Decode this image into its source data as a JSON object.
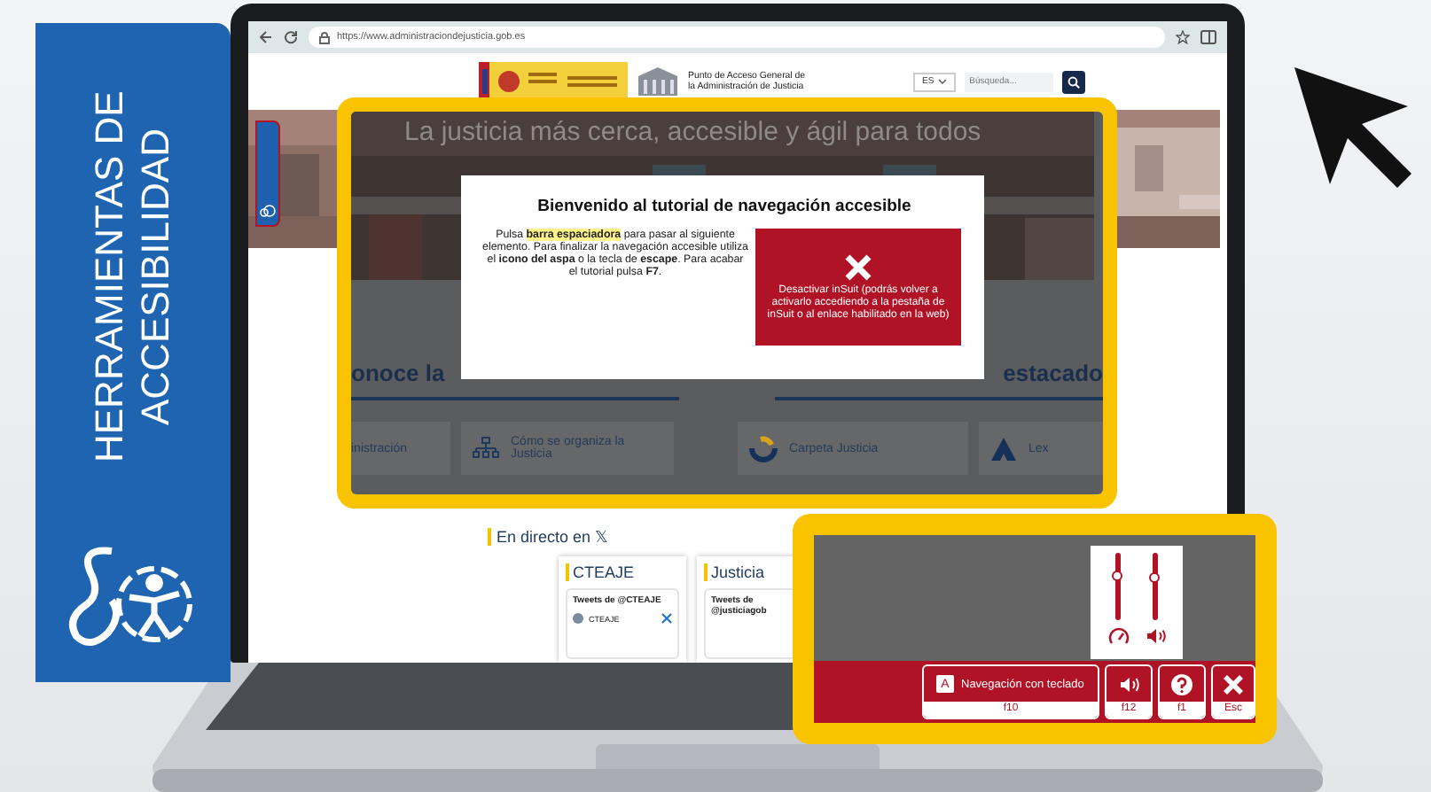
{
  "side_panel": {
    "title": "HERRAMIENTAS DE ACCESIBILIDAD"
  },
  "browser": {
    "url": "https://www.administraciondejusticia.gob.es"
  },
  "header": {
    "org_title": "Punto de Acceso General de la Administración de Justicia",
    "language": "ES",
    "search_placeholder": "Búsqueda..."
  },
  "hero": {
    "tagline": "La justicia más cerca, accesible y ágil para todos"
  },
  "page_sections": {
    "headings": [
      "onoce la",
      "estacado"
    ],
    "links": [
      {
        "kind": "text",
        "label": "inistración"
      },
      {
        "kind": "org",
        "label": "Cómo se organiza la Justicia"
      },
      {
        "kind": "folder",
        "label": "Carpeta Justicia"
      },
      {
        "kind": "lex",
        "label": "Lex"
      }
    ]
  },
  "tutorial_modal": {
    "title": "Bienvenido al tutorial de navegación accesible",
    "body": [
      {
        "kind": "plain",
        "text": "Pulsa "
      },
      {
        "kind": "highlight",
        "text": "barra espaciadora"
      },
      {
        "kind": "plain",
        "text": " para pasar al siguiente elemento. Para finalizar la navegación accesible utiliza el "
      },
      {
        "kind": "bold",
        "text": "icono del aspa"
      },
      {
        "kind": "plain",
        "text": " o la tecla de "
      },
      {
        "kind": "bold",
        "text": "escape"
      },
      {
        "kind": "plain",
        "text": ". Para acabar el tutorial pulsa "
      },
      {
        "kind": "bold",
        "text": "F7"
      },
      {
        "kind": "plain",
        "text": "."
      }
    ],
    "close_button": "Desactivar inSuit (podrás volver a activarlo accediendo a la pestaña de inSuit o al enlace habilitado en la web)"
  },
  "live_feed": {
    "heading": "En directo en 𝕏",
    "cards": [
      {
        "title": "CTEAJE",
        "subtitle": "Tweets de @CTEAJE",
        "author": "CTEAJE"
      },
      {
        "title": "Justicia",
        "subtitle": "Tweets de @justiciagob"
      }
    ]
  },
  "toolbar": {
    "sliders": [
      {
        "kind": "speed",
        "level": 0.65
      },
      {
        "kind": "volume",
        "level": 0.63
      }
    ],
    "buttons": [
      {
        "kind": "keyboard",
        "key_letter": "A",
        "label": "Navegación con teclado",
        "shortcut": "f10"
      },
      {
        "kind": "audio",
        "shortcut": "f12"
      },
      {
        "kind": "help",
        "shortcut": "f1"
      },
      {
        "kind": "close",
        "shortcut": "Esc"
      }
    ]
  }
}
